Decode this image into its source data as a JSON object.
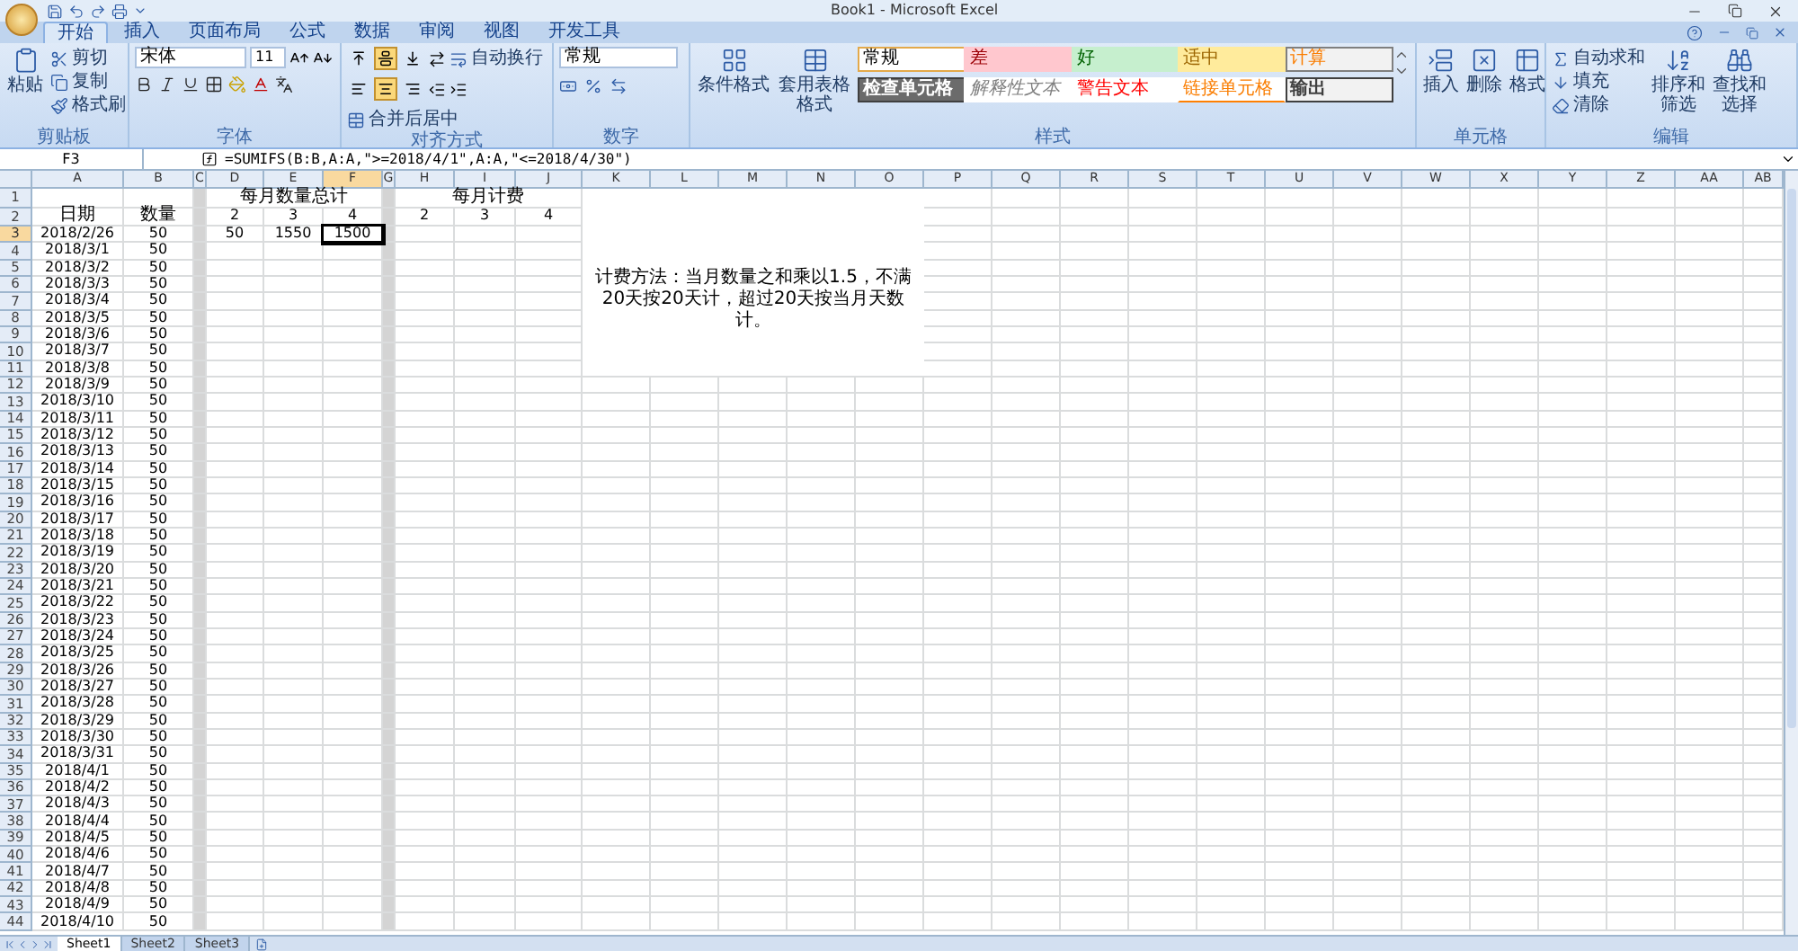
{
  "window": {
    "title": "Book1 - Microsoft Excel"
  },
  "ribbon": {
    "tabs": [
      {
        "label": "开始",
        "selected": true
      },
      {
        "label": "插入",
        "selected": false
      },
      {
        "label": "页面布局",
        "selected": false
      },
      {
        "label": "公式",
        "selected": false
      },
      {
        "label": "数据",
        "selected": false
      },
      {
        "label": "审阅",
        "selected": false
      },
      {
        "label": "视图",
        "selected": false
      },
      {
        "label": "开发工具",
        "selected": false
      }
    ],
    "clipboard": {
      "label": "剪贴板",
      "paste": "粘贴",
      "items": [
        "剪切",
        "复制",
        "格式刷"
      ]
    },
    "font": {
      "label": "字体",
      "font_name": "宋体",
      "font_size": "11"
    },
    "alignment": {
      "label": "对齐方式",
      "wrap_text": "自动换行",
      "merge_center": "合并后居中",
      "vertical": [
        {
          "selected": false
        },
        {
          "selected": true
        },
        {
          "selected": false
        }
      ],
      "horizontal": [
        {
          "selected": false
        },
        {
          "selected": true
        },
        {
          "selected": false
        }
      ]
    },
    "number": {
      "label": "数字",
      "format": "常规"
    },
    "styles": {
      "label": "样式",
      "conditional": "条件格式",
      "table_format": "套用表格格式",
      "cell_styles": [
        {
          "text": "常规",
          "kind": "normal"
        },
        {
          "text": "差",
          "kind": "bad"
        },
        {
          "text": "好",
          "kind": "good"
        },
        {
          "text": "适中",
          "kind": "neutral"
        },
        {
          "text": "计算",
          "kind": "calculation"
        },
        {
          "text": "检查单元格",
          "kind": "check"
        },
        {
          "text": "解释性文本",
          "kind": "explanatory"
        },
        {
          "text": "警告文本",
          "kind": "warning"
        },
        {
          "text": "链接单元格",
          "kind": "linked"
        },
        {
          "text": "输出",
          "kind": "output"
        }
      ]
    },
    "cells": {
      "label": "单元格",
      "items": [
        "插入",
        "删除",
        "格式"
      ]
    },
    "editing": {
      "label": "编辑",
      "items": [
        "自动求和",
        "填充",
        "清除"
      ],
      "sort": "排序和筛选",
      "find": "查找和选择"
    }
  },
  "formula_bar": {
    "name_box": "F3",
    "formula": "=SUMIFS(B:B,A:A,\">=2018/4/1\",A:A,\"<=2018/4/30\")"
  },
  "sheet": {
    "columns": [
      {
        "label": "A",
        "selected": false
      },
      {
        "label": "B",
        "selected": false
      },
      {
        "label": "C",
        "selected": false
      },
      {
        "label": "D",
        "selected": false
      },
      {
        "label": "E",
        "selected": false
      },
      {
        "label": "F",
        "selected": true
      },
      {
        "label": "G",
        "selected": false
      },
      {
        "label": "H",
        "selected": false
      },
      {
        "label": "I",
        "selected": false
      },
      {
        "label": "J",
        "selected": false
      },
      {
        "label": "K",
        "selected": false
      },
      {
        "label": "L",
        "selected": false
      },
      {
        "label": "M",
        "selected": false
      },
      {
        "label": "N",
        "selected": false
      },
      {
        "label": "O",
        "selected": false
      },
      {
        "label": "P",
        "selected": false
      },
      {
        "label": "Q",
        "selected": false
      },
      {
        "label": "R",
        "selected": false
      },
      {
        "label": "S",
        "selected": false
      },
      {
        "label": "T",
        "selected": false
      },
      {
        "label": "U",
        "selected": false
      },
      {
        "label": "V",
        "selected": false
      },
      {
        "label": "W",
        "selected": false
      },
      {
        "label": "X",
        "selected": false
      },
      {
        "label": "Y",
        "selected": false
      },
      {
        "label": "Z",
        "selected": false
      },
      {
        "label": "AA",
        "selected": false
      },
      {
        "label": "AB",
        "selected": false
      }
    ],
    "monthly_total": {
      "title": "每月数量总计",
      "months": [
        "2",
        "3",
        "4"
      ],
      "totals": [
        {
          "text": "50",
          "selected": false
        },
        {
          "text": "1550",
          "selected": false
        },
        {
          "text": "1500",
          "selected": true
        }
      ]
    },
    "monthly_fee": {
      "title": "每月计费",
      "months": [
        "2",
        "3",
        "4"
      ]
    },
    "note": "计费方法：当月数量之和乘以1.5，不满20天按20天计，超过20天按当月天数计。",
    "rows": [
      {
        "number": "1",
        "selected": false
      },
      {
        "number": "2",
        "selected": false,
        "date": "日期",
        "quantity": "数量"
      },
      {
        "number": "3",
        "selected": true,
        "date": "2018/2/26",
        "quantity": "50"
      },
      {
        "number": "4",
        "selected": false,
        "date": "2018/3/1",
        "quantity": "50"
      },
      {
        "number": "5",
        "selected": false,
        "date": "2018/3/2",
        "quantity": "50"
      },
      {
        "number": "6",
        "selected": false,
        "date": "2018/3/3",
        "quantity": "50"
      },
      {
        "number": "7",
        "selected": false,
        "date": "2018/3/4",
        "quantity": "50"
      },
      {
        "number": "8",
        "selected": false,
        "date": "2018/3/5",
        "quantity": "50"
      },
      {
        "number": "9",
        "selected": false,
        "date": "2018/3/6",
        "quantity": "50"
      },
      {
        "number": "10",
        "selected": false,
        "date": "2018/3/7",
        "quantity": "50"
      },
      {
        "number": "11",
        "selected": false,
        "date": "2018/3/8",
        "quantity": "50"
      },
      {
        "number": "12",
        "selected": false,
        "date": "2018/3/9",
        "quantity": "50"
      },
      {
        "number": "13",
        "selected": false,
        "date": "2018/3/10",
        "quantity": "50"
      },
      {
        "number": "14",
        "selected": false,
        "date": "2018/3/11",
        "quantity": "50"
      },
      {
        "number": "15",
        "selected": false,
        "date": "2018/3/12",
        "quantity": "50"
      },
      {
        "number": "16",
        "selected": false,
        "date": "2018/3/13",
        "quantity": "50"
      },
      {
        "number": "17",
        "selected": false,
        "date": "2018/3/14",
        "quantity": "50"
      },
      {
        "number": "18",
        "selected": false,
        "date": "2018/3/15",
        "quantity": "50"
      },
      {
        "number": "19",
        "selected": false,
        "date": "2018/3/16",
        "quantity": "50"
      },
      {
        "number": "20",
        "selected": false,
        "date": "2018/3/17",
        "quantity": "50"
      },
      {
        "number": "21",
        "selected": false,
        "date": "2018/3/18",
        "quantity": "50"
      },
      {
        "number": "22",
        "selected": false,
        "date": "2018/3/19",
        "quantity": "50"
      },
      {
        "number": "23",
        "selected": false,
        "date": "2018/3/20",
        "quantity": "50"
      },
      {
        "number": "24",
        "selected": false,
        "date": "2018/3/21",
        "quantity": "50"
      },
      {
        "number": "25",
        "selected": false,
        "date": "2018/3/22",
        "quantity": "50"
      },
      {
        "number": "26",
        "selected": false,
        "date": "2018/3/23",
        "quantity": "50"
      },
      {
        "number": "27",
        "selected": false,
        "date": "2018/3/24",
        "quantity": "50"
      },
      {
        "number": "28",
        "selected": false,
        "date": "2018/3/25",
        "quantity": "50"
      },
      {
        "number": "29",
        "selected": false,
        "date": "2018/3/26",
        "quantity": "50"
      },
      {
        "number": "30",
        "selected": false,
        "date": "2018/3/27",
        "quantity": "50"
      },
      {
        "number": "31",
        "selected": false,
        "date": "2018/3/28",
        "quantity": "50"
      },
      {
        "number": "32",
        "selected": false,
        "date": "2018/3/29",
        "quantity": "50"
      },
      {
        "number": "33",
        "selected": false,
        "date": "2018/3/30",
        "quantity": "50"
      },
      {
        "number": "34",
        "selected": false,
        "date": "2018/3/31",
        "quantity": "50"
      },
      {
        "number": "35",
        "selected": false,
        "date": "2018/4/1",
        "quantity": "50"
      },
      {
        "number": "36",
        "selected": false,
        "date": "2018/4/2",
        "quantity": "50"
      },
      {
        "number": "37",
        "selected": false,
        "date": "2018/4/3",
        "quantity": "50"
      },
      {
        "number": "38",
        "selected": false,
        "date": "2018/4/4",
        "quantity": "50"
      },
      {
        "number": "39",
        "selected": false,
        "date": "2018/4/5",
        "quantity": "50"
      },
      {
        "number": "40",
        "selected": false,
        "date": "2018/4/6",
        "quantity": "50"
      },
      {
        "number": "41",
        "selected": false,
        "date": "2018/4/7",
        "quantity": "50"
      },
      {
        "number": "42",
        "selected": false,
        "date": "2018/4/8",
        "quantity": "50"
      },
      {
        "number": "43",
        "selected": false,
        "date": "2018/4/9",
        "quantity": "50"
      },
      {
        "number": "44",
        "selected": false,
        "date": "2018/4/10",
        "quantity": "50"
      }
    ]
  },
  "sheet_tabs": [
    {
      "label": "Sheet1",
      "selected": true
    },
    {
      "label": "Sheet2",
      "selected": false
    },
    {
      "label": "Sheet3",
      "selected": false
    }
  ]
}
